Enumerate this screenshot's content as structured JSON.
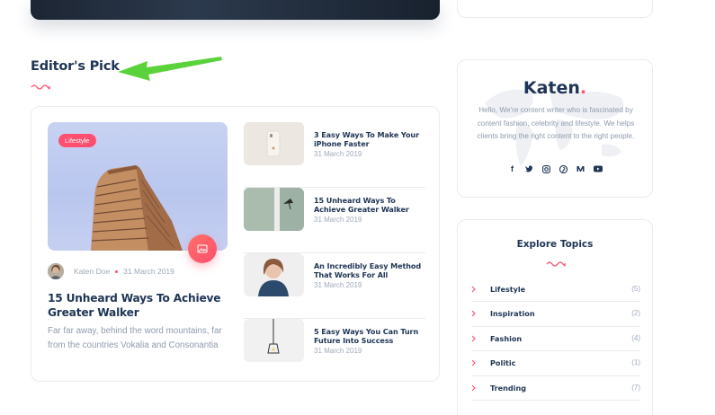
{
  "section": {
    "title": "Editor's Pick"
  },
  "featured": {
    "category": "Lifestyle",
    "author": "Katen Doe",
    "date": "31 March 2019",
    "title": "15 Unheard Ways To Achieve Greater Walker",
    "excerpt": "Far far away, behind the word mountains, far from the countries Vokalia and Consonantia",
    "format_icon": "image-icon"
  },
  "posts": [
    {
      "title": "3 Easy Ways To Make Your iPhone Faster",
      "date": "31 March 2019"
    },
    {
      "title": "15 Unheard Ways To Achieve Greater Walker",
      "date": "31 March 2019"
    },
    {
      "title": "An Incredibly Easy Method That Works For All",
      "date": "31 March 2019"
    },
    {
      "title": "5 Easy Ways You Can Turn Future Into Success",
      "date": "31 March 2019"
    }
  ],
  "about": {
    "logo": "Katen",
    "logo_dot": ".",
    "text": "Hello, We're content writer who is fascinated by content fashion, celebrity and lifestyle. We helps clients bring the right content to the right people.",
    "social": [
      "facebook-icon",
      "twitter-icon",
      "instagram-icon",
      "pinterest-icon",
      "medium-icon",
      "youtube-icon"
    ]
  },
  "topics": {
    "title": "Explore Topics",
    "items": [
      {
        "name": "Lifestyle",
        "count": "(5)"
      },
      {
        "name": "Inspiration",
        "count": "(2)"
      },
      {
        "name": "Fashion",
        "count": "(4)"
      },
      {
        "name": "Politic",
        "count": "(1)"
      },
      {
        "name": "Trending",
        "count": "(7)"
      }
    ]
  },
  "colors": {
    "accent": "#fe4f70",
    "heading": "#203656",
    "muted": "#9faabb",
    "arrow": "#5ad33a"
  }
}
